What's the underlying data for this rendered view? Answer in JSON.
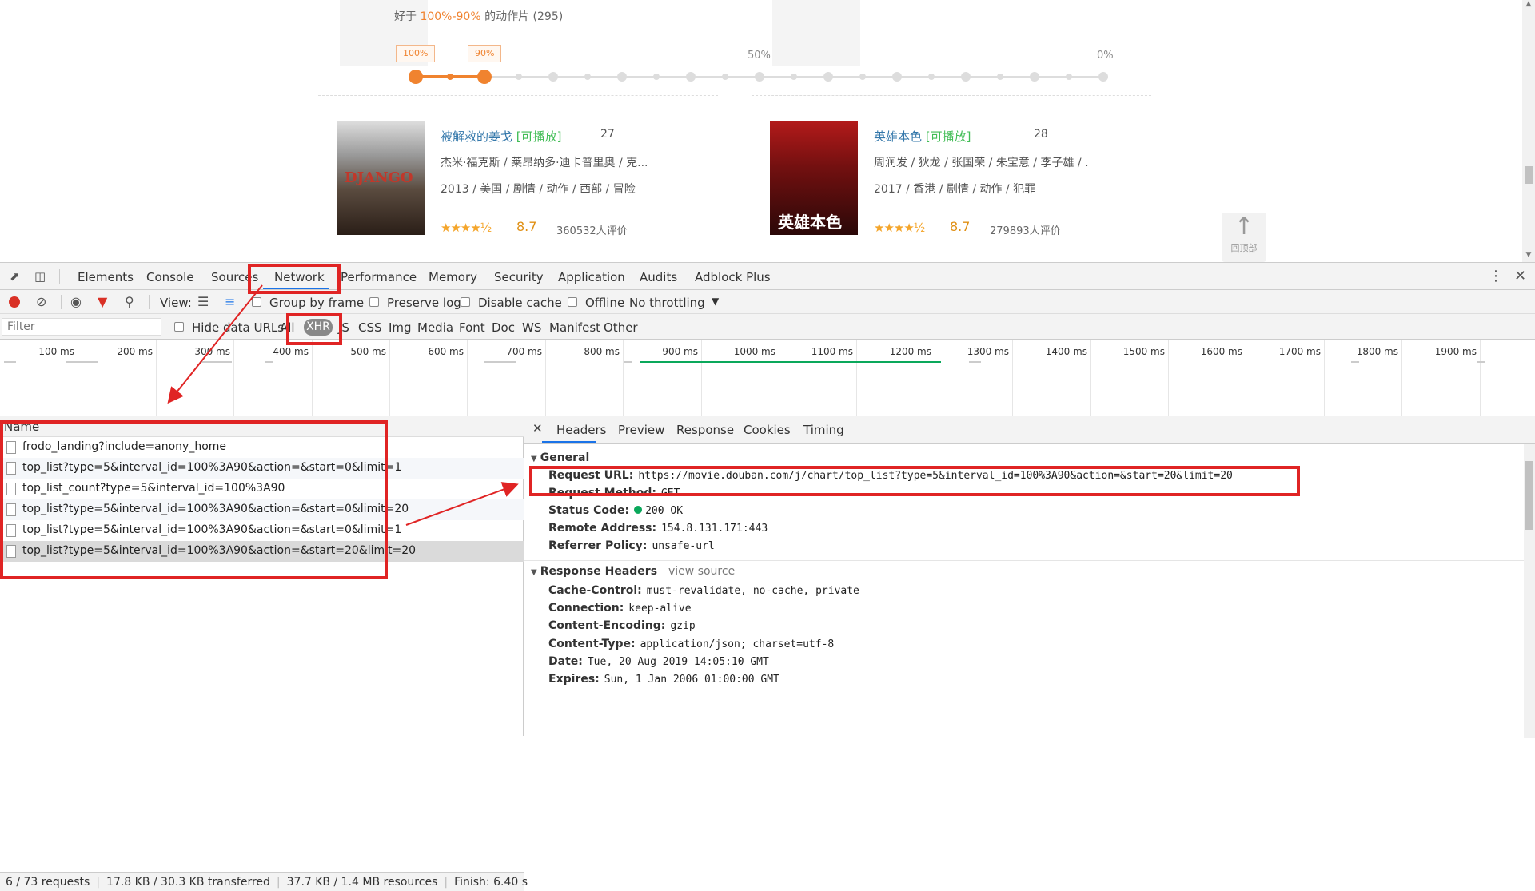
{
  "page": {
    "summary_prefix": "好于",
    "summary_pct": "100%-90%",
    "summary_suffix": "的动作片 (295)",
    "badge_high": "100%",
    "badge_low": "90%",
    "scale_mid": "50%",
    "scale_end": "0%",
    "slider_selected_range": [
      100,
      90
    ],
    "movies": [
      {
        "rank": "27",
        "title": "被解救的姜戈",
        "playable": "[可播放]",
        "cast": "杰米·福克斯 / 莱昂纳多·迪卡普里奥 / 克...",
        "info": "2013 / 美国 / 剧情 / 动作 / 西部 / 冒险",
        "stars": "★★★★½",
        "score": "8.7",
        "votes": "360532人评价",
        "poster_text": "DJANGO"
      },
      {
        "rank": "28",
        "title": "英雄本色",
        "playable": "[可播放]",
        "cast": "周润发 / 狄龙 / 张国荣 / 朱宝意 / 李子雄 / ...",
        "info": "2017 / 香港 / 剧情 / 动作 / 犯罪",
        "stars": "★★★★½",
        "score": "8.7",
        "votes": "279893人评价",
        "poster_text": "英雄本色"
      }
    ],
    "back_to_top": "回顶部"
  },
  "devtools": {
    "tabs": [
      "Elements",
      "Console",
      "Sources",
      "Network",
      "Performance",
      "Memory",
      "Security",
      "Application",
      "Audits",
      "Adblock Plus"
    ],
    "active_tab": "Network",
    "toolbar": {
      "view_label": "View:",
      "group_by_frame": "Group by frame",
      "preserve_log": "Preserve log",
      "disable_cache": "Disable cache",
      "offline": "Offline",
      "throttling": "No throttling"
    },
    "filter": {
      "placeholder": "Filter",
      "hide_data_urls": "Hide data URLs",
      "types": [
        "All",
        "XHR",
        "JS",
        "CSS",
        "Img",
        "Media",
        "Font",
        "Doc",
        "WS",
        "Manifest",
        "Other"
      ],
      "active_type": "XHR"
    },
    "timeline_ticks": [
      "100 ms",
      "200 ms",
      "300 ms",
      "400 ms",
      "500 ms",
      "600 ms",
      "700 ms",
      "800 ms",
      "900 ms",
      "1000 ms",
      "1100 ms",
      "1200 ms",
      "1300 ms",
      "1400 ms",
      "1500 ms",
      "1600 ms",
      "1700 ms",
      "1800 ms",
      "1900 ms",
      "200"
    ],
    "name_header": "Name",
    "requests": [
      "frodo_landing?include=anony_home",
      "top_list?type=5&interval_id=100%3A90&action=&start=0&limit=1",
      "top_list_count?type=5&interval_id=100%3A90",
      "top_list?type=5&interval_id=100%3A90&action=&start=0&limit=20",
      "top_list?type=5&interval_id=100%3A90&action=&start=0&limit=1",
      "top_list?type=5&interval_id=100%3A90&action=&start=20&limit=20"
    ],
    "status": {
      "requests": "6 / 73 requests",
      "transferred": "17.8 KB / 30.3 KB transferred",
      "resources": "37.7 KB / 1.4 MB resources",
      "finish": "Finish: 6.40 s"
    },
    "detail_tabs": [
      "Headers",
      "Preview",
      "Response",
      "Cookies",
      "Timing"
    ],
    "general": {
      "title": "General",
      "request_url_k": "Request URL:",
      "request_url_v": "https://movie.douban.com/j/chart/top_list?type=5&interval_id=100%3A90&action=&start=20&limit=20",
      "method_k": "Request Method:",
      "method_v": "GET",
      "status_k": "Status Code:",
      "status_v": "200 OK",
      "remote_k": "Remote Address:",
      "remote_v": "154.8.131.171:443",
      "referrer_k": "Referrer Policy:",
      "referrer_v": "unsafe-url"
    },
    "response_headers": {
      "title": "Response Headers",
      "view_source": "view source",
      "items": [
        {
          "k": "Cache-Control:",
          "v": "must-revalidate, no-cache, private"
        },
        {
          "k": "Connection:",
          "v": "keep-alive"
        },
        {
          "k": "Content-Encoding:",
          "v": "gzip"
        },
        {
          "k": "Content-Type:",
          "v": "application/json; charset=utf-8"
        },
        {
          "k": "Date:",
          "v": "Tue, 20 Aug 2019 14:05:10 GMT"
        },
        {
          "k": "Expires:",
          "v": "Sun, 1 Jan 2006 01:00:00 GMT"
        }
      ]
    }
  },
  "colors": {
    "accent_orange": "#f0832f",
    "link_blue": "#3377aa",
    "playable_green": "#42bd56",
    "devtools_blue": "#1a73e8",
    "annotation_red": "#e02424",
    "status_green": "#0aa85b"
  }
}
